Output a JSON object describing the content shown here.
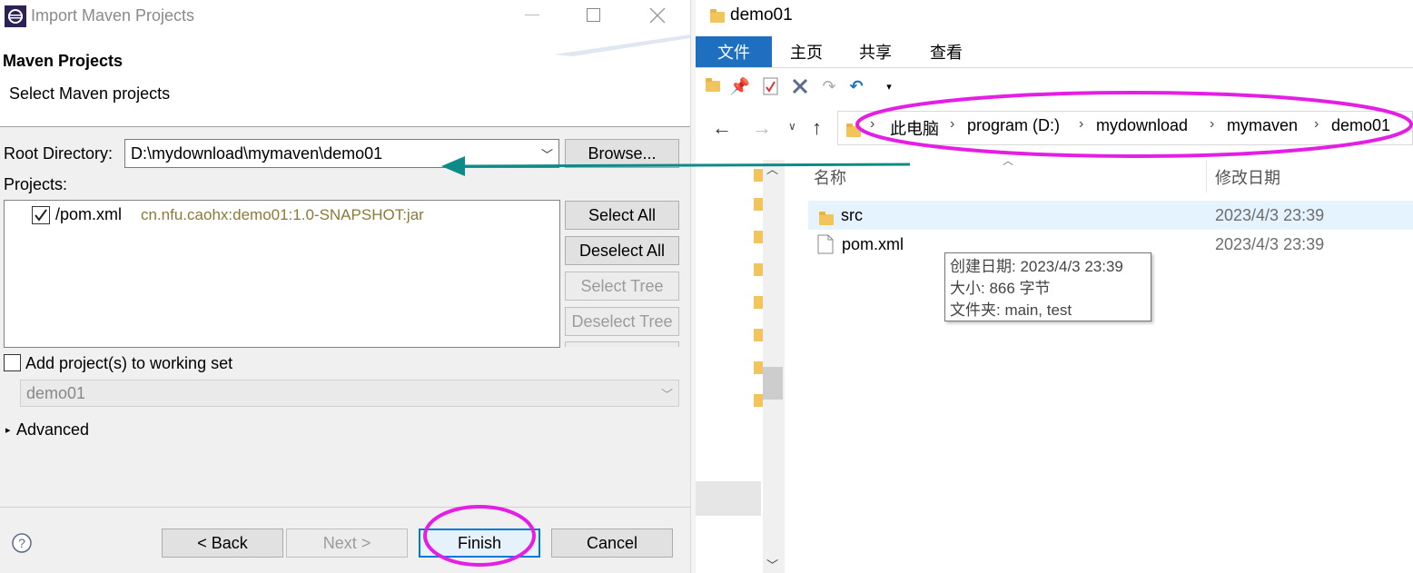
{
  "dialog": {
    "title": "Import Maven Projects",
    "header_title": "Maven Projects",
    "header_subtitle": "Select Maven projects",
    "root_label": "Root Directory:",
    "root_value": "D:\\mydownload\\mymaven\\demo01",
    "browse_label": "Browse...",
    "projects_label": "Projects:",
    "project_item": {
      "name": "/pom.xml",
      "coords": "cn.nfu.caohx:demo01:1.0-SNAPSHOT:jar",
      "checked": true
    },
    "select_all": "Select All",
    "deselect_all": "Deselect All",
    "select_tree": "Select Tree",
    "deselect_tree": "Deselect Tree",
    "working_set_label": "Add project(s) to working set",
    "working_set_value": "demo01",
    "advanced_label": "Advanced",
    "back_label": "< Back",
    "next_label": "Next >",
    "finish_label": "Finish",
    "cancel_label": "Cancel",
    "help_glyph": "?"
  },
  "explorer": {
    "title": "demo01",
    "tabs": [
      "文件",
      "主页",
      "共享",
      "查看"
    ],
    "breadcrumb": [
      "此电脑",
      "program (D:)",
      "mydownload",
      "mymaven",
      "demo01"
    ],
    "columns": {
      "name": "名称",
      "modified": "修改日期"
    },
    "files": [
      {
        "name": "src",
        "modified": "2023/4/3 23:39",
        "type": "folder"
      },
      {
        "name": "pom.xml",
        "modified": "2023/4/3 23:39",
        "type": "file"
      }
    ],
    "tooltip": [
      "创建日期: 2023/4/3 23:39",
      "大小: 866 字节",
      "文件夹: main, test"
    ]
  },
  "colors": {
    "highlight_ellipse": "#e51ee5",
    "arrow": "#0e8b86",
    "ribbon_active": "#1e6fc0",
    "selected_row": "#e5f3ff",
    "maven_coords": "#8a7a3a"
  }
}
